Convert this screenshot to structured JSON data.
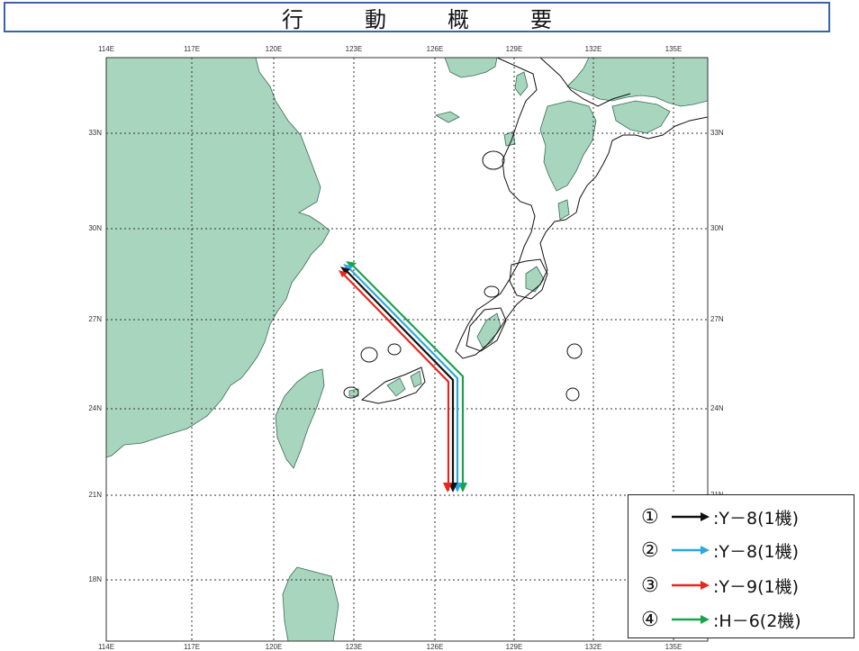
{
  "title": "行　動　概　要",
  "map": {
    "lon_labels": [
      "114E",
      "117E",
      "120E",
      "123E",
      "126E",
      "129E",
      "132E",
      "135E"
    ],
    "lat_labels": [
      "33N",
      "30N",
      "27N",
      "24N",
      "21N",
      "18N"
    ],
    "land_color": "#a8d5bd",
    "land_border": "#3a6b55"
  },
  "legend": [
    {
      "num": "①",
      "label": ":Y－8(1機)",
      "color": "#111111"
    },
    {
      "num": "②",
      "label": ":Y－8(1機)",
      "color": "#2aa8e0"
    },
    {
      "num": "③",
      "label": ":Y－9(1機)",
      "color": "#e8261e"
    },
    {
      "num": "④",
      "label": ":H－6(2機)",
      "color": "#1aa34a"
    }
  ],
  "flight_paths": [
    {
      "id": 1,
      "type": "Y-8",
      "count": 1,
      "color": "#111111"
    },
    {
      "id": 2,
      "type": "Y-8",
      "count": 1,
      "color": "#2aa8e0"
    },
    {
      "id": 3,
      "type": "Y-9",
      "count": 1,
      "color": "#e8261e"
    },
    {
      "id": 4,
      "type": "H-6",
      "count": 2,
      "color": "#1aa34a"
    }
  ]
}
